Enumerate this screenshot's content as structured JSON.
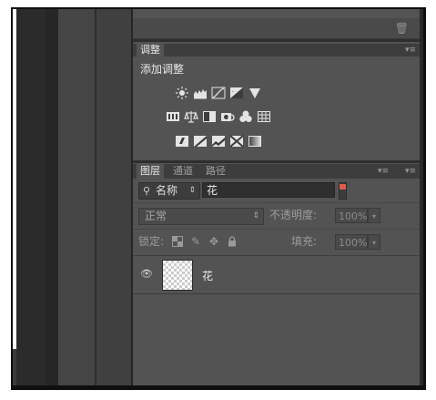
{
  "adjustments_panel": {
    "tab_label": "调整",
    "add_label": "添加调整"
  },
  "layers_panel": {
    "tabs": [
      {
        "label": "图层",
        "active": true
      },
      {
        "label": "通道",
        "active": false
      },
      {
        "label": "路径",
        "active": false
      }
    ],
    "filter_kind": "名称",
    "filter_value": "花",
    "blend_mode": "正常",
    "opacity_label": "不透明度:",
    "opacity_value": "100%",
    "lock_label": "锁定:",
    "fill_label": "填充:",
    "fill_value": "100%",
    "layers": [
      {
        "name": "花",
        "visible": true
      }
    ]
  },
  "colors": {
    "panel_bg": "#535353",
    "filter_toggle_active": "#e05a4e"
  }
}
